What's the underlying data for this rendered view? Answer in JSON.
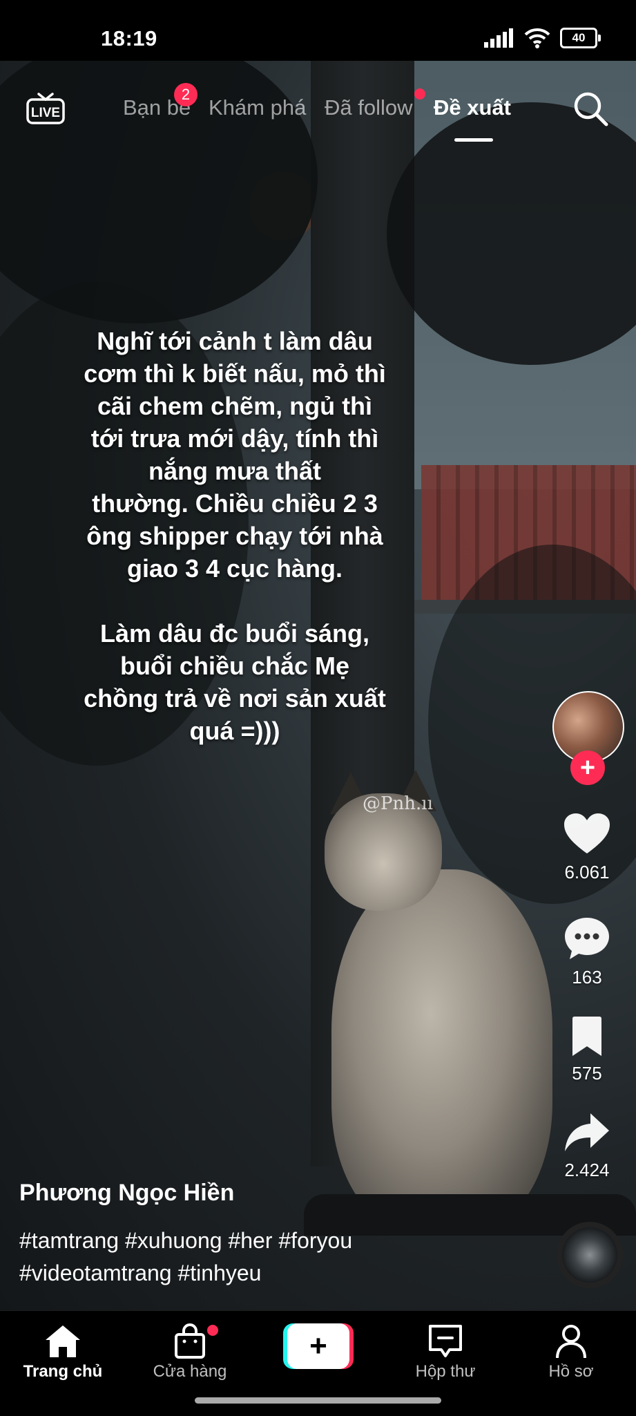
{
  "status_bar": {
    "time": "18:19",
    "battery": "40"
  },
  "top_nav": {
    "tabs": [
      {
        "label": "Bạn bè",
        "badge": "2"
      },
      {
        "label": "Khám phá"
      },
      {
        "label": "Đã follow",
        "dot": true
      },
      {
        "label": "Đề xuất",
        "active": true
      }
    ]
  },
  "video": {
    "overlay_text": "Nghĩ tới cảnh t làm dâu\ncơm thì k biết nấu, mỏ thì\ncãi chem chẽm, ngủ thì\ntới trưa mới dậy, tính thì\nnắng mưa thất\nthường. Chiều chiều 2 3\nông shipper chạy tới nhà\ngiao 3 4 cục hàng.\n\nLàm dâu đc buổi sáng,\nbuổi chiều chắc Mẹ\nchồng trả về nơi sản xuất\nquá =)))",
    "watermark": "@Pnh.ıı",
    "username": "Phương Ngọc Hiền",
    "hashtags": "#tamtrang #xuhuong #her #foryou\n#videotamtrang #tinhyeu"
  },
  "actions": {
    "likes": "6.061",
    "comments": "163",
    "saves": "575",
    "shares": "2.424"
  },
  "bottom_nav": {
    "home": "Trang chủ",
    "shop": "Cửa hàng",
    "inbox": "Hộp thư",
    "profile": "Hồ sơ"
  },
  "colors": {
    "accent": "#fe2c55",
    "cyan": "#25f4ee"
  }
}
